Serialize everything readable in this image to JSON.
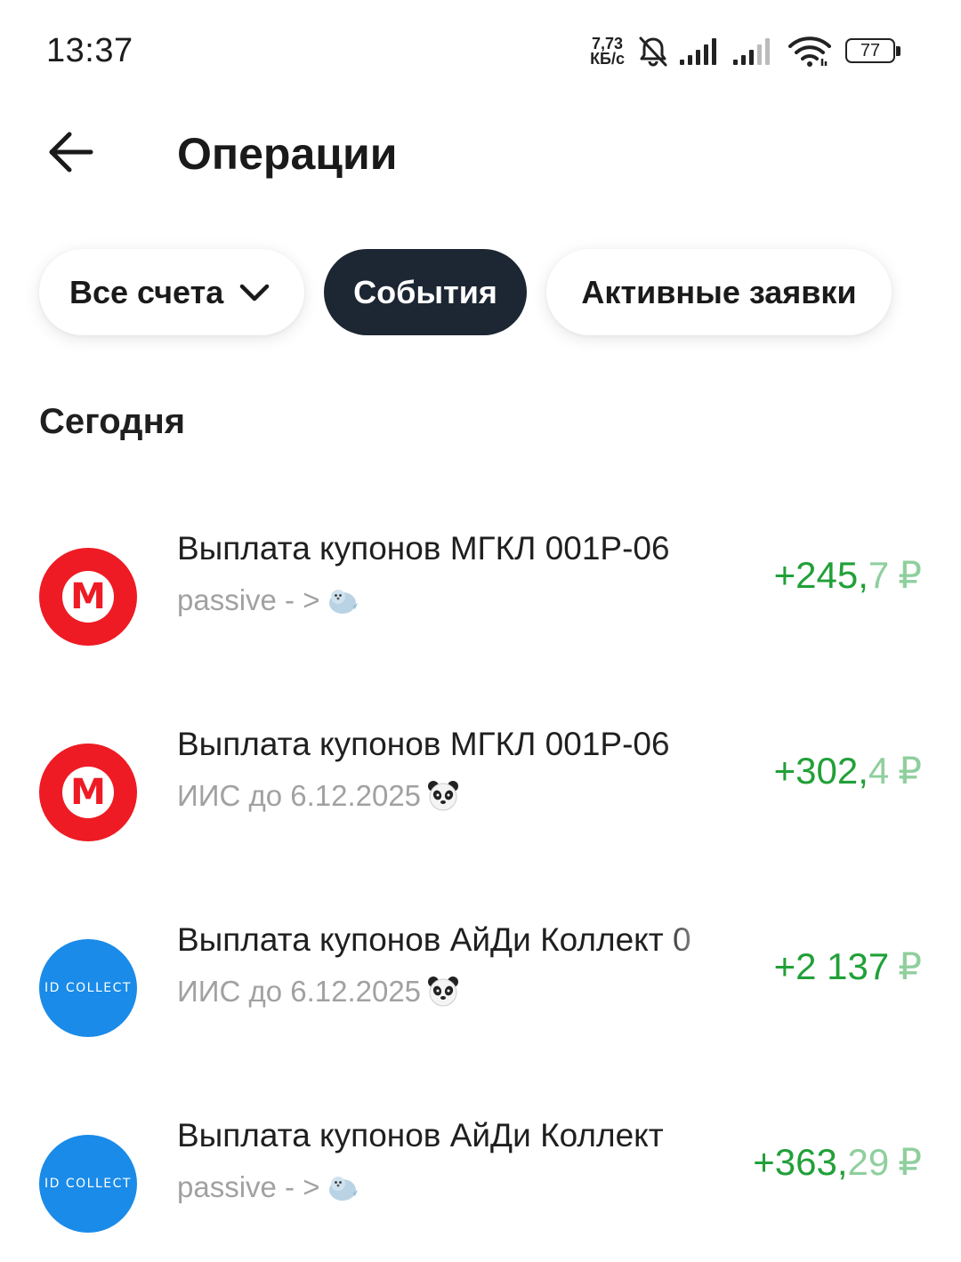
{
  "status_bar": {
    "time": "13:37",
    "net_speed_value": "7,73",
    "net_speed_unit": "КБ/с",
    "battery": "77",
    "icons": [
      "bell-muted-icon",
      "signal-icon",
      "signal-weak-icon",
      "wifi-icon",
      "battery-icon"
    ]
  },
  "header": {
    "title": "Операции",
    "back_icon": "arrow-left-icon"
  },
  "filters": {
    "accounts_label": "Все счета",
    "events_label": "События",
    "active_orders_label": "Активные заявки"
  },
  "section": {
    "heading": "Сегодня"
  },
  "operations": [
    {
      "title": "Выплата купонов МГКЛ 001Р-06",
      "subtitle": "passive - >",
      "subtitle_icon": "seal-icon",
      "amount_int": "+245,",
      "amount_frac": "7",
      "currency": "₽",
      "logo": "М",
      "logo_type": "mgkl"
    },
    {
      "title": "Выплата купонов МГКЛ 001Р-06",
      "subtitle": "ИИС до 6.12.2025",
      "subtitle_icon": "panda-icon",
      "amount_int": "+302,",
      "amount_frac": "4",
      "currency": "₽",
      "logo": "М",
      "logo_type": "mgkl"
    },
    {
      "title": "Выплата купонов АйДи Коллект 0",
      "subtitle": "ИИС до 6.12.2025",
      "subtitle_icon": "panda-icon",
      "amount_int": "+2 137",
      "amount_frac": "",
      "currency": "₽",
      "logo": "ID COLLECT",
      "logo_type": "idcollect"
    },
    {
      "title": "Выплата купонов АйДи Коллект",
      "subtitle": "passive - >",
      "subtitle_icon": "seal-icon",
      "amount_int": "+363,",
      "amount_frac": "29",
      "currency": "₽",
      "logo": "ID COLLECT",
      "logo_type": "idcollect"
    }
  ],
  "colors": {
    "positive_amount": "#21a038",
    "chip_selected_bg": "#1d2633",
    "mgkl_red": "#ee1b24",
    "idcollect_blue": "#1a8be8"
  }
}
